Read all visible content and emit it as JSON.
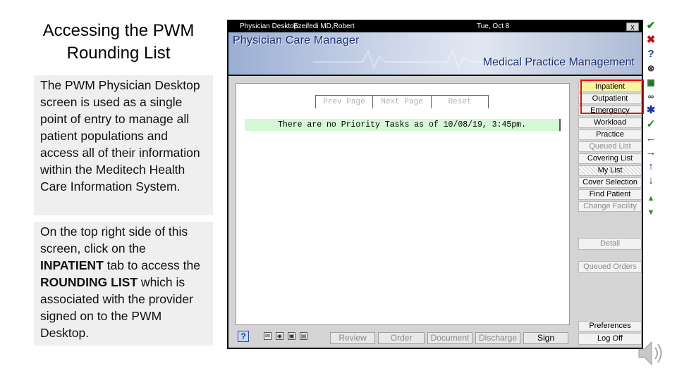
{
  "slide": {
    "title_line1": "Accessing the PWM",
    "title_line2": "Rounding List",
    "para1": "The PWM Physician Desktop screen is used as a single point of entry to manage all patient populations and access all of their information within the Meditech Health Care Information System.",
    "para2_a": "On the top right side of this screen, click on the ",
    "para2_b": "INPATIENT",
    "para2_c": " tab to access the ",
    "para2_d": "ROUNDING LIST",
    "para2_e": " which is associated with the provider signed on to the PWM Desktop."
  },
  "window": {
    "app_name": "Physician Desktop",
    "user": "Ezeifedi MD,Robert",
    "date": "Tue, Oct 8",
    "close_glyph": "x"
  },
  "banner": {
    "title": "Physician Care Manager",
    "subtitle": "Medical Practice Management"
  },
  "panel": {
    "prev_page": "Prev Page",
    "next_page": "Next Page",
    "reset": "Reset",
    "priority_msg": "There are no Priority Tasks as of 10/08/19, 3:45pm."
  },
  "tabs": {
    "inpatient": "Inpatient",
    "outpatient": "Outpatient",
    "emergency": "Emergency",
    "workload": "Workload",
    "practice": "Practice",
    "queued_list": "Queued List",
    "covering_list": "Covering List",
    "my_list": "My List",
    "cover_selection": "Cover Selection",
    "find_patient": "Find Patient",
    "change_facility": "Change Facility",
    "detail": "Detail",
    "queued_orders": "Queued Orders",
    "preferences": "Preferences",
    "log_off": "Log Off"
  },
  "bottom": {
    "help": "?",
    "review": "Review",
    "order": "Order",
    "document": "Document",
    "discharge": "Discharge",
    "sign": "Sign"
  },
  "toolbar_icons": [
    "check-icon",
    "x-icon",
    "question-icon",
    "binoculars-icon",
    "calendar-icon",
    "glasses-icon",
    "asterisk-icon",
    "check-pencil-icon",
    "arrow-left-icon",
    "arrow-right-icon",
    "arrow-up-icon",
    "arrow-down-icon",
    "arrow-top-icon",
    "arrow-bottom-icon"
  ],
  "colors": {
    "highlight_box": "#e01010",
    "priority_bg": "#d4f7d4",
    "banner_text": "#1a2f70"
  }
}
